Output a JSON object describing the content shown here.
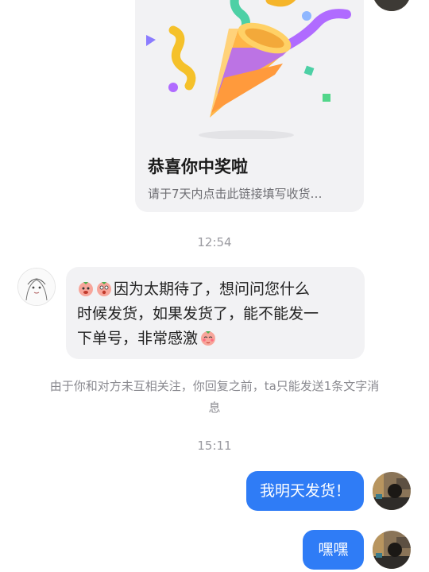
{
  "card": {
    "title": "恭喜你中奖啦",
    "subtitle": "请于7天内点击此链接填写收货…"
  },
  "timestamps": [
    "12:54",
    "15:11"
  ],
  "incoming_message": {
    "lines": [
      "因为太期待了，想问问您什么",
      "时候发货，如果发货了，能不能发一",
      "下单号，非常感激"
    ]
  },
  "notice": {
    "line1": "由于你和对方未互相关注，你回复之前，ta只能发送1条文字消",
    "line2": "息"
  },
  "outgoing_messages": [
    "我明天发货！",
    "嘿嘿"
  ],
  "colors": {
    "bubble_out": "#2f7cf6",
    "bubble_in": "#f2f2f4",
    "timestamp": "#9a9aa0"
  }
}
